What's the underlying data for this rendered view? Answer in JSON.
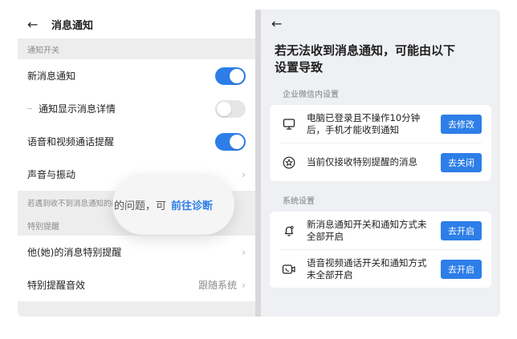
{
  "left": {
    "back_icon": "arrow-left-icon",
    "title": "消息通知",
    "section_switch": "通知开关",
    "rows": [
      {
        "label": "新消息通知",
        "toggle": "on"
      },
      {
        "label": "通知显示消息详情",
        "toggle": "off"
      },
      {
        "label": "语音和视频通话提醒",
        "toggle": "on"
      },
      {
        "label": "声音与振动"
      }
    ],
    "diagnose_text": "若遇到收不到消息通知的问题，可",
    "bubble_text": "的问题，可",
    "bubble_link": "前往诊断",
    "section_special": "特别提醒",
    "special_rows": [
      {
        "label": "他(她)的消息特别提醒"
      },
      {
        "label": "特别提醒音效",
        "value": "跟随系统"
      }
    ]
  },
  "right": {
    "back_icon": "arrow-left-icon",
    "title_line1": "若无法收到消息通知，可能由以下",
    "title_line2": "设置导致",
    "section_wechat": "企业微信内设置",
    "wechat_items": [
      {
        "icon": "monitor-icon",
        "text_line1": "电脑已登录且不操作10分钟",
        "text_line2": "后，手机才能收到通知",
        "button": "去修改"
      },
      {
        "icon": "star-circle-icon",
        "text_line1": "当前仅接收特别提醒的消息",
        "text_line2": "",
        "button": "去关闭"
      }
    ],
    "section_system": "系统设置",
    "system_items": [
      {
        "icon": "bell-icon",
        "text_line1": "新消息通知开关和通知方式未",
        "text_line2": "全部开启",
        "button": "去开启"
      },
      {
        "icon": "video-call-icon",
        "text_line1": "语音视频通话开关和通知方式",
        "text_line2": "未全部开启",
        "button": "去开启"
      }
    ]
  },
  "colors": {
    "accent": "#2d7ee8",
    "toggle_off": "#e6e6e6"
  }
}
